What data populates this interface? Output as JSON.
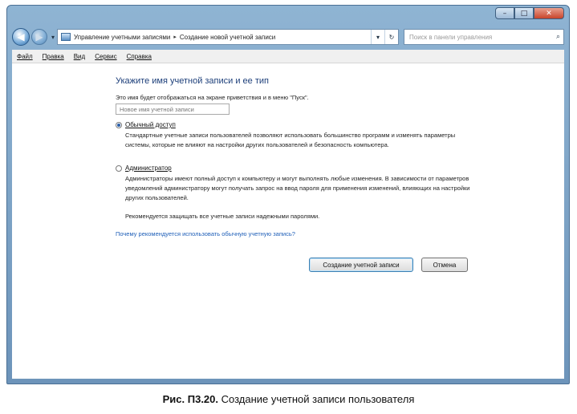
{
  "window": {
    "caption_buttons": {
      "minimize": "–",
      "maximize": "□",
      "close": "✕"
    }
  },
  "nav": {
    "back_glyph": "◀",
    "forward_glyph": "▶",
    "dropdown_glyph": "▾",
    "breadcrumb": [
      "Управление учетными записями",
      "Создание новой учетной записи"
    ],
    "breadcrumb_separator": "▸",
    "address_dropdown_glyph": "▾",
    "refresh_glyph": "↻",
    "search_placeholder": "Поиск в панели управления",
    "search_icon": "⌕"
  },
  "menu": {
    "items": [
      "Файл",
      "Правка",
      "Вид",
      "Сервис",
      "Справка"
    ]
  },
  "form": {
    "heading": "Укажите имя учетной записи и ее тип",
    "hint": "Это имя будет отображаться на экране приветствия и в меню \"Пуск\".",
    "name_placeholder": "Новое имя учетной записи",
    "options": [
      {
        "label": "Обычный доступ",
        "selected": true,
        "description": "Стандартные учетные записи пользователей позволяют использовать большинство программ и изменять параметры системы, которые не влияют на настройки других пользователей и безопасность компьютера."
      },
      {
        "label": "Администратор",
        "selected": false,
        "description": "Администраторы имеют полный доступ к компьютеру и могут выполнять любые изменения. В зависимости от параметров уведомлений администратору могут получать запрос на ввод пароля для применения изменений, влияющих на настройки других пользователей."
      }
    ],
    "recommendation": "Рекомендуется защищать все учетные записи надежными паролями.",
    "help_link": "Почему рекомендуется использовать обычную учетную запись?",
    "create_button": "Создание учетной записи",
    "cancel_button": "Отмена"
  },
  "figure_caption": {
    "number": "Рис. П3.20.",
    "text": " Создание учетной записи пользователя"
  }
}
